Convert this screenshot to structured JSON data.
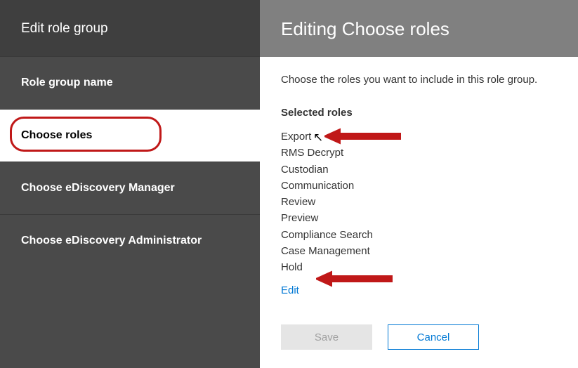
{
  "sidebar": {
    "title": "Edit role group",
    "items": [
      {
        "label": "Role group name",
        "active": false
      },
      {
        "label": "Choose roles",
        "active": true
      },
      {
        "label": "Choose eDiscovery Manager",
        "active": false
      },
      {
        "label": "Choose eDiscovery Administrator",
        "active": false
      }
    ]
  },
  "main": {
    "header": "Editing Choose roles",
    "description": "Choose the roles you want to include in this role group.",
    "section_label": "Selected roles",
    "roles": [
      "Export",
      "RMS Decrypt",
      "Custodian",
      "Communication",
      "Review",
      "Preview",
      "Compliance Search",
      "Case Management",
      "Hold"
    ],
    "edit_link": "Edit"
  },
  "footer": {
    "save": "Save",
    "cancel": "Cancel"
  },
  "annotations": {
    "arrow_color": "#c01818",
    "highlight_target_1": "Export",
    "highlight_target_2": "Edit"
  }
}
